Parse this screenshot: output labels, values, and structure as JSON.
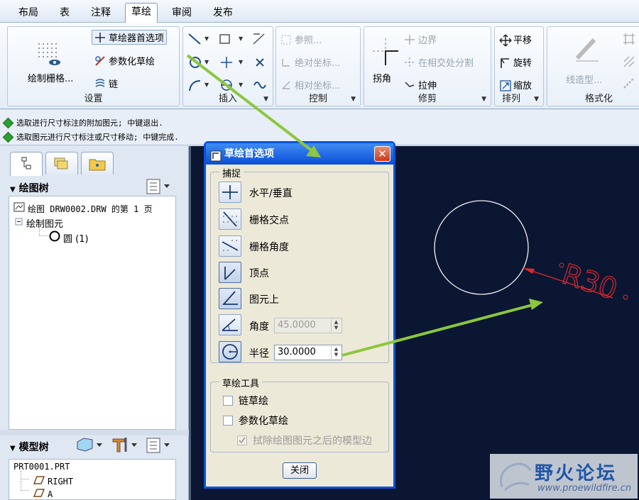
{
  "menu": {
    "tabs": [
      "布局",
      "表",
      "注释",
      "草绘",
      "审阅",
      "发布"
    ],
    "active": "草绘"
  },
  "ribbon": {
    "settings": {
      "grid_btn": "绘制栅格...",
      "prefs_btn": "草绘器首选项",
      "param_btn": "参数化草绘",
      "chain_btn": "链",
      "label": "设置"
    },
    "insert": {
      "label": "插入"
    },
    "control": {
      "ref_btn": "参照...",
      "abs_btn": "绝对坐标...",
      "rel_btn": "相对坐标...",
      "label": "控制"
    },
    "trim": {
      "corner_btn": "拐角",
      "boundary_btn": "边界",
      "split_btn": "在相交处分割",
      "stretch_btn": "拉伸",
      "label": "修剪"
    },
    "arrange": {
      "move_btn": "平移",
      "rotate_btn": "旋转",
      "scale_btn": "缩放",
      "label": "排列"
    },
    "format": {
      "linestyle_btn": "线造型...",
      "label": "格式化"
    }
  },
  "messages": [
    "选取进行尺寸标注的附加图元; 中键退出.",
    "选取图元进行尺寸标注或尺寸移动; 中键完成."
  ],
  "drawing_tree": {
    "title": "绘图树",
    "nodes": [
      "绘图 DRW0002.DRW 的第 1 页",
      "绘制图元",
      "圆 (1)"
    ]
  },
  "model_tree": {
    "title": "模型树",
    "nodes": [
      "PRT0001.PRT",
      "RIGHT",
      "A"
    ]
  },
  "canvas": {
    "dimension_text": "R30"
  },
  "dialog": {
    "title": "草绘首选项",
    "close_x": "✕",
    "snap_legend": "捕捉",
    "snap_items": [
      "水平/垂直",
      "栅格交点",
      "栅格角度",
      "顶点",
      "图元上"
    ],
    "angle_label": "角度",
    "angle_value": "45.0000",
    "radius_label": "半径",
    "radius_value": "30.0000",
    "tools_legend": "草绘工具",
    "chk_chain": "链草绘",
    "chk_param": "参数化草绘",
    "chk_remove": "拭除绘图图元之后的模型边",
    "close_btn": "关闭"
  },
  "watermark": {
    "title": "野火论坛",
    "url": "www.proewildfire.cn"
  },
  "colors": {
    "annotation_arrow": "#8dc63f",
    "dim_red": "#e0282a",
    "canvas_bg": "#0b1633",
    "title_blue": "#0a4ed6"
  }
}
